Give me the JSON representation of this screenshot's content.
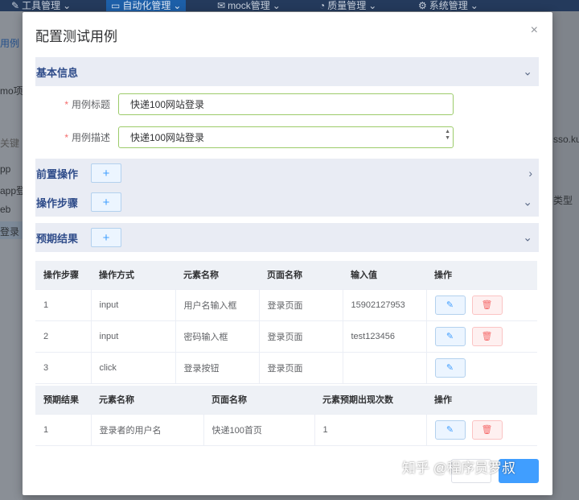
{
  "background": {
    "nav": [
      {
        "icon": "wrench-icon",
        "label": "工具管理"
      },
      {
        "icon": "monitor-icon",
        "label": "自动化管理"
      },
      {
        "icon": "envelope-icon",
        "label": "mock管理"
      },
      {
        "icon": "pie-icon",
        "label": "质量管理"
      },
      {
        "icon": "gear-icon",
        "label": "系统管理"
      }
    ],
    "left_texts": [
      "用例",
      "mo项目",
      "关键",
      "pp",
      "app登",
      "eb",
      "登录"
    ],
    "right_texts": [
      "sso.ku",
      "类型"
    ]
  },
  "modal": {
    "title": "配置测试用例",
    "close": "×",
    "basic": {
      "title": "基本信息",
      "fields": [
        {
          "required": "*",
          "label": "用例标题",
          "value": "快递100网站登录"
        },
        {
          "required": "*",
          "label": "用例描述",
          "value": "快递100网站登录"
        }
      ]
    },
    "pre": {
      "title": "前置操作",
      "add": "+"
    },
    "steps": {
      "title": "操作步骤",
      "add": "+"
    },
    "expect": {
      "title": "预期结果",
      "add": "+"
    },
    "steps_table": {
      "headers": [
        "操作步骤",
        "操作方式",
        "元素名称",
        "页面名称",
        "输入值",
        "操作"
      ],
      "rows": [
        [
          "1",
          "input",
          "用户名输入框",
          "登录页面",
          "15902127953"
        ],
        [
          "2",
          "input",
          "密码输入框",
          "登录页面",
          "test123456"
        ],
        [
          "3",
          "click",
          "登录按钮",
          "登录页面",
          ""
        ]
      ]
    },
    "expect_table": {
      "headers": [
        "预期结果",
        "元素名称",
        "页面名称",
        "元素预期出现次数",
        "操作"
      ],
      "rows": [
        [
          "1",
          "登录者的用户名",
          "快递100首页",
          "1"
        ]
      ]
    },
    "watermark": "知乎 @程序员罗叔"
  }
}
